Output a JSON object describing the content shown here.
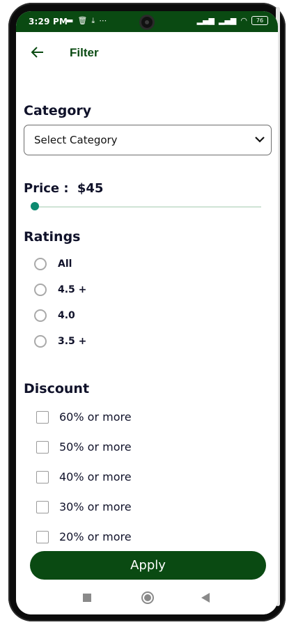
{
  "status_bar": {
    "time": "3:29 PM",
    "left_icons": [
      "message-icon",
      "trash-icon",
      "download-icon",
      "more-dots-icon"
    ],
    "battery": "76"
  },
  "header": {
    "title": "Filter",
    "back_icon": "arrow-left-icon"
  },
  "category": {
    "title": "Category",
    "select_value": "Select Category"
  },
  "price": {
    "label": "Price :",
    "value": "$45",
    "slider_fraction": 0.0
  },
  "ratings": {
    "title": "Ratings",
    "options": [
      "All",
      "4.5 +",
      "4.0",
      "3.5 +"
    ]
  },
  "discount": {
    "title": "Discount",
    "options": [
      "60% or more",
      "50% or more",
      "40% or more",
      "30% or more",
      "20% or more"
    ]
  },
  "apply_button": {
    "label": "Apply"
  },
  "colors": {
    "brand_green": "#0a4a12",
    "slider_thumb": "#0d8a70",
    "text_dark": "#10122a"
  }
}
